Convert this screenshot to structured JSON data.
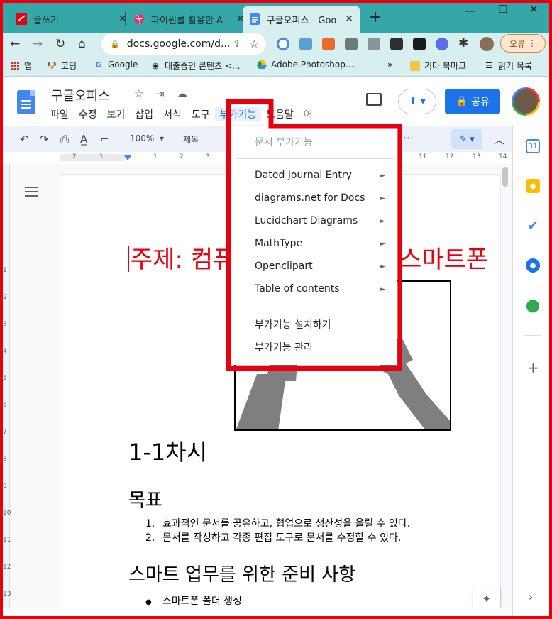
{
  "browser": {
    "tabs": [
      {
        "label": "글쓰기",
        "close": "✕"
      },
      {
        "label": "파이썬를 활용한 A",
        "close": "✕"
      },
      {
        "label": "구글오피스 - Goo",
        "close": "✕"
      }
    ],
    "new_tab": "+",
    "window_controls": {
      "minimize": "—",
      "maximize": "☐",
      "close": "✕"
    },
    "url": "docs.google.com/d...",
    "error_button": "오류",
    "bookmarks": [
      "앱",
      "코딩",
      "Google",
      "대출중인 콘텐츠 <...",
      "Adobe.Photoshop....",
      "»",
      "기타 북마크",
      "읽기 목록"
    ]
  },
  "docs": {
    "title": "구글오피스",
    "menu": [
      "파일",
      "수정",
      "보기",
      "삽입",
      "서식",
      "도구",
      "부가기능",
      "도움말",
      "어"
    ],
    "share_label": "공유",
    "zoom": "100%",
    "style": "제목",
    "ruler_ticks": [
      "2",
      "1",
      "1",
      "2",
      "3",
      "11",
      "12",
      "13",
      "14"
    ],
    "vruler_ticks": [
      "1",
      "2",
      "3",
      "4",
      "5",
      "6",
      "7",
      "8",
      "9",
      "10",
      "11",
      "12",
      "13"
    ]
  },
  "document": {
    "heading_left": "주제: 컴퓨",
    "heading_right": "스마트폰",
    "h1": "1-1차시",
    "goal_heading": "목표",
    "goals": [
      {
        "num": "1.",
        "text": "효과적인 문서를 공유하고, 협업으로 생산성을 올릴 수 있다."
      },
      {
        "num": "2.",
        "text": "문서를 작성하고 각종 편집 도구로 문서를 수정할 수 있다."
      }
    ],
    "prep_heading": "스마트 업무를 위한 준비 사항",
    "prep_items": [
      "스마트폰 폴더 생성"
    ]
  },
  "dropdown": {
    "header": "문서 부가기능",
    "items": [
      "Dated Journal Entry",
      "diagrams.net for Docs",
      "Lucidchart Diagrams",
      "MathType",
      "Openclipart",
      "Table of contents"
    ],
    "arrow": "►",
    "footer_items": [
      "부가기능 설치하기",
      "부가기능 관리"
    ]
  },
  "side_panel": {
    "calendar_day": "31"
  },
  "colors": {
    "highlight": "#e8000f",
    "tabstrip": "#35a7a8",
    "docs_blue": "#1a73e8"
  }
}
